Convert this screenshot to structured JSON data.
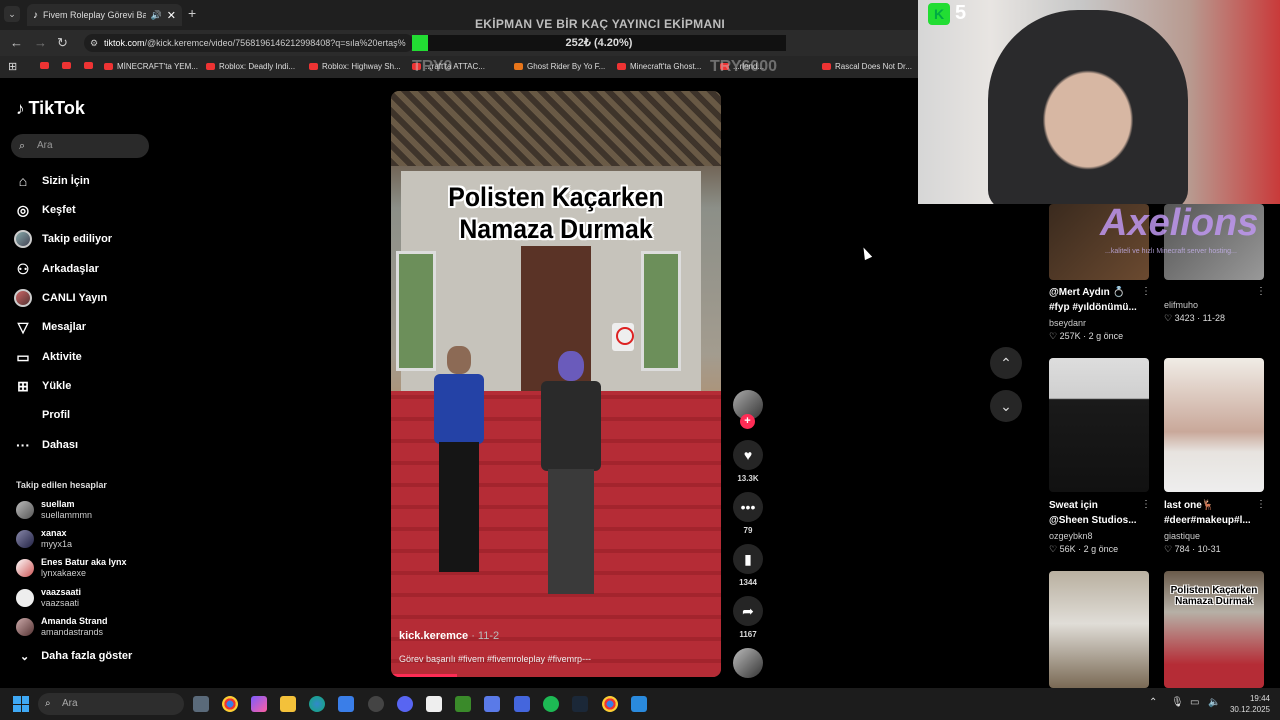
{
  "browser": {
    "tab_title": "Fivem Roleplay Görevi Başa",
    "url_host": "tiktok.com",
    "url_path": "/@kick.keremce/video/7568196146212998408?q=sıla%20ertaş%",
    "bookmarks": [
      "MİNECRAFT'ta YEM...",
      "Roblox: Deadly Indi...",
      "Roblox: Highway Sh...",
      "...raft'ta ATTAC...",
      "Ghost Rider By Yo F...",
      "Minecraft'ta Ghost...",
      "...rlend...",
      "Rascal Does Not Dr..."
    ]
  },
  "stream_overlay": {
    "title": "EKİPMAN VE BİR KAÇ YAYINCI EKİPMANI",
    "progress_text": "252₺ (4.20%)",
    "progress_percent": 4.2,
    "try_left": "TRY0",
    "try_right": "TRY6000",
    "cam_badge_count": "5",
    "accent": "#22dd33"
  },
  "sidebar": {
    "logo": "TikTok",
    "search_placeholder": "Ara",
    "nav": [
      {
        "label": "Sizin İçin",
        "icon": "home-icon"
      },
      {
        "label": "Keşfet",
        "icon": "compass-icon"
      },
      {
        "label": "Takip ediliyor",
        "icon": "avatar"
      },
      {
        "label": "Arkadaşlar",
        "icon": "friends-icon"
      },
      {
        "label": "CANLI Yayın",
        "icon": "avatar"
      },
      {
        "label": "Mesajlar",
        "icon": "send-icon"
      },
      {
        "label": "Aktivite",
        "icon": "inbox-icon"
      },
      {
        "label": "Yükle",
        "icon": "plus-square-icon"
      },
      {
        "label": "Profil",
        "icon": ""
      },
      {
        "label": "Dahası",
        "icon": "more-icon"
      }
    ],
    "following_header": "Takip edilen hesaplar",
    "accounts": [
      {
        "name": "suellam",
        "handle": "suellammmn"
      },
      {
        "name": "xanax",
        "handle": "myyx1a"
      },
      {
        "name": "Enes Batur aka lynx",
        "handle": "lynxakaexe"
      },
      {
        "name": "vaazsaati",
        "handle": "vaazsaati"
      },
      {
        "name": "Amanda Strand",
        "handle": "amandastrands"
      }
    ],
    "show_more": "Daha fazla göster"
  },
  "video": {
    "overlay_title_line1": "Polisten Kaçarken",
    "overlay_title_line2": "Namaza Durmak",
    "author": "kick.keremce",
    "date": "· 11-2",
    "caption": "Görev başarılı #fivem #fivemroleplay #fivemrp---",
    "likes": "13.3K",
    "comments": "79",
    "saves": "1344",
    "shares": "1167",
    "progress_percent": 20
  },
  "grid": {
    "axelions": "Axelions",
    "axelions_sub": "...kaliteli ve hızlı Minecraft server hosting...",
    "cards": [
      {
        "title1": "@Mert Aydın 💍",
        "title2": "#fyp #yıldönümü...",
        "user": "bseydanr",
        "likes": "257K",
        "when": "2 g önce"
      },
      {
        "title1": "",
        "title2": "",
        "user": "elifmuho",
        "likes": "3423",
        "when": "11-28"
      },
      {
        "title1": "Sweat için",
        "title2": "@Sheen Studios...",
        "user": "ozgeybkn8",
        "likes": "56K",
        "when": "2 g önce"
      },
      {
        "title1": "last one🦌",
        "title2": "#deer#makeup#l...",
        "user": "giastique",
        "likes": "784",
        "when": "10-31"
      },
      {
        "thumb_text1": "Polisten Kaçarken",
        "thumb_text2": "Namaza Durmak"
      }
    ]
  },
  "taskbar": {
    "search_placeholder": "Ara",
    "time": "19:44",
    "date": "30.12.2025"
  }
}
